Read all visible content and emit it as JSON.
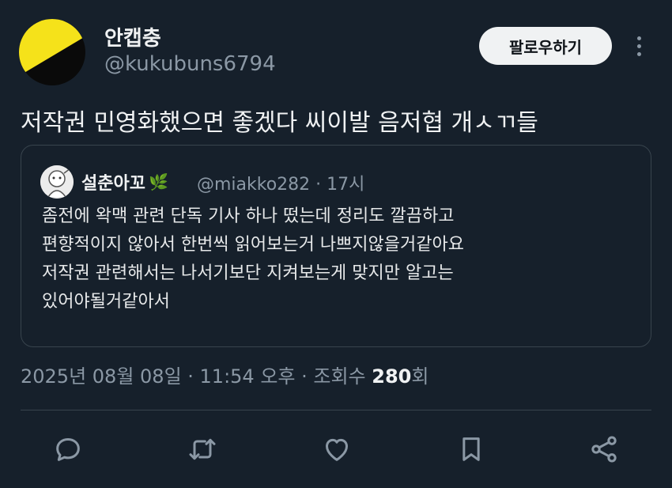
{
  "author": {
    "display_name": "안캡충",
    "handle": "@kukubuns6794",
    "avatar_colors": [
      "#f5e21a",
      "#0a0a0a"
    ]
  },
  "follow_label": "팔로우하기",
  "tweet_text": "저작권 민영화했으면 좋겠다 씨이발 음저협 개ㅅㄲ들",
  "quote": {
    "display_name": "설춘아꼬",
    "name_emoji": "🌿",
    "handle_time": "@miakko282 · 17시",
    "lines": [
      "좀전에 왁맥 관련 단독 기사 하나 떴는데 정리도 깔끔하고",
      "편향적이지 않아서 한번씩 읽어보는거 나쁘지않을거같아요",
      "저작권 관련해서는 나서기보단 지켜보는게 맞지만 알고는",
      "있어야될거같아서"
    ]
  },
  "meta": {
    "timestamp": "2025년 08월 08일 · 11:54 오후 · 조회수",
    "views": "280",
    "views_suffix": "회"
  },
  "actions": [
    "reply-icon",
    "retweet-icon",
    "like-icon",
    "bookmark-icon",
    "share-icon"
  ],
  "colors": {
    "background": "#16202b",
    "secondary_text": "#8b98a5",
    "border": "#38444d"
  }
}
